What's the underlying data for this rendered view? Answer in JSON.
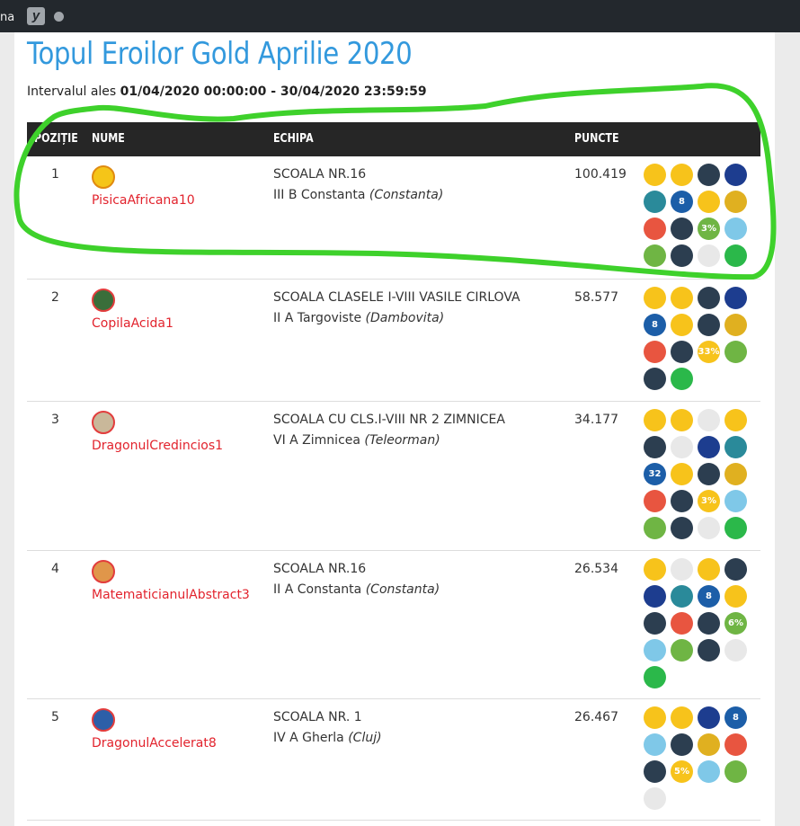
{
  "topbar": {
    "left_text": "na"
  },
  "page": {
    "title": "Topul Eroilor Gold Aprilie 2020",
    "interval_label": "Intervalul ales",
    "interval_value": "01/04/2020 00:00:00 - 30/04/2020 23:59:59"
  },
  "table": {
    "headers": {
      "pos": "POZIȚIE",
      "name": "NUME",
      "team": "ECHIPA",
      "points": "PUNCTE"
    },
    "rows": [
      {
        "pos": "1",
        "user": "PisicaAfricana10",
        "school": "SCOALA NR.16",
        "class": "III B Constanta",
        "county": "(Constanta)",
        "points": "100.419"
      },
      {
        "pos": "2",
        "user": "CopilaAcida1",
        "school": "SCOALA CLASELE I-VIII VASILE CIRLOVA",
        "class": "II A Targoviste",
        "county": "(Dambovita)",
        "points": "58.577"
      },
      {
        "pos": "3",
        "user": "DragonulCredincios1",
        "school": "SCOALA CU CLS.I-VIII NR 2 ZIMNICEA",
        "class": "VI A Zimnicea",
        "county": "(Teleorman)",
        "points": "34.177"
      },
      {
        "pos": "4",
        "user": "MatematicianulAbstract3",
        "school": "SCOALA NR.16",
        "class": "II A Constanta",
        "county": "(Constanta)",
        "points": "26.534"
      },
      {
        "pos": "5",
        "user": "DragonulAccelerat8",
        "school": "SCOALA NR. 1",
        "class": "IV A Gherla",
        "county": "(Cluj)",
        "points": "26.467"
      }
    ]
  },
  "badges": {
    "row1": [
      "yellow",
      "yellow",
      "dark",
      "navy",
      "teal",
      "blue",
      "yellow",
      "gold",
      "red",
      "dark",
      "green",
      "ltblue",
      "green",
      "dark",
      "white",
      "lime"
    ],
    "row2": [
      "yellow",
      "yellow",
      "dark",
      "navy",
      "blue",
      "yellow",
      "dark",
      "gold",
      "red",
      "dark",
      "yellow",
      "green",
      "dark",
      "lime"
    ],
    "row3": [
      "yellow",
      "yellow",
      "white",
      "yellow",
      "dark",
      "white",
      "navy",
      "teal",
      "blue",
      "yellow",
      "dark",
      "gold",
      "red",
      "dark",
      "yellow",
      "ltblue",
      "green",
      "dark",
      "white",
      "lime"
    ],
    "row4": [
      "yellow",
      "white",
      "yellow",
      "dark",
      "navy",
      "teal",
      "blue",
      "yellow",
      "dark",
      "red",
      "dark",
      "green",
      "ltblue",
      "green",
      "dark",
      "white",
      "lime"
    ],
    "row5": [
      "yellow",
      "yellow",
      "navy",
      "blue",
      "ltblue",
      "dark",
      "gold",
      "red",
      "dark",
      "yellow",
      "ltblue",
      "green",
      "white"
    ]
  },
  "badge_texts": {
    "row1": {
      "5": "8",
      "10": "3%"
    },
    "row2": {
      "4": "8",
      "10": "33%"
    },
    "row3": {
      "8": "32",
      "14": "3%"
    },
    "row4": {
      "6": "8",
      "11": "6%"
    },
    "row5": {
      "3": "8",
      "9": "5%"
    }
  },
  "colors": {
    "title": "#3399dd",
    "username": "#e2232d",
    "header_bg": "#262626",
    "highlight": "#3ed12b"
  }
}
